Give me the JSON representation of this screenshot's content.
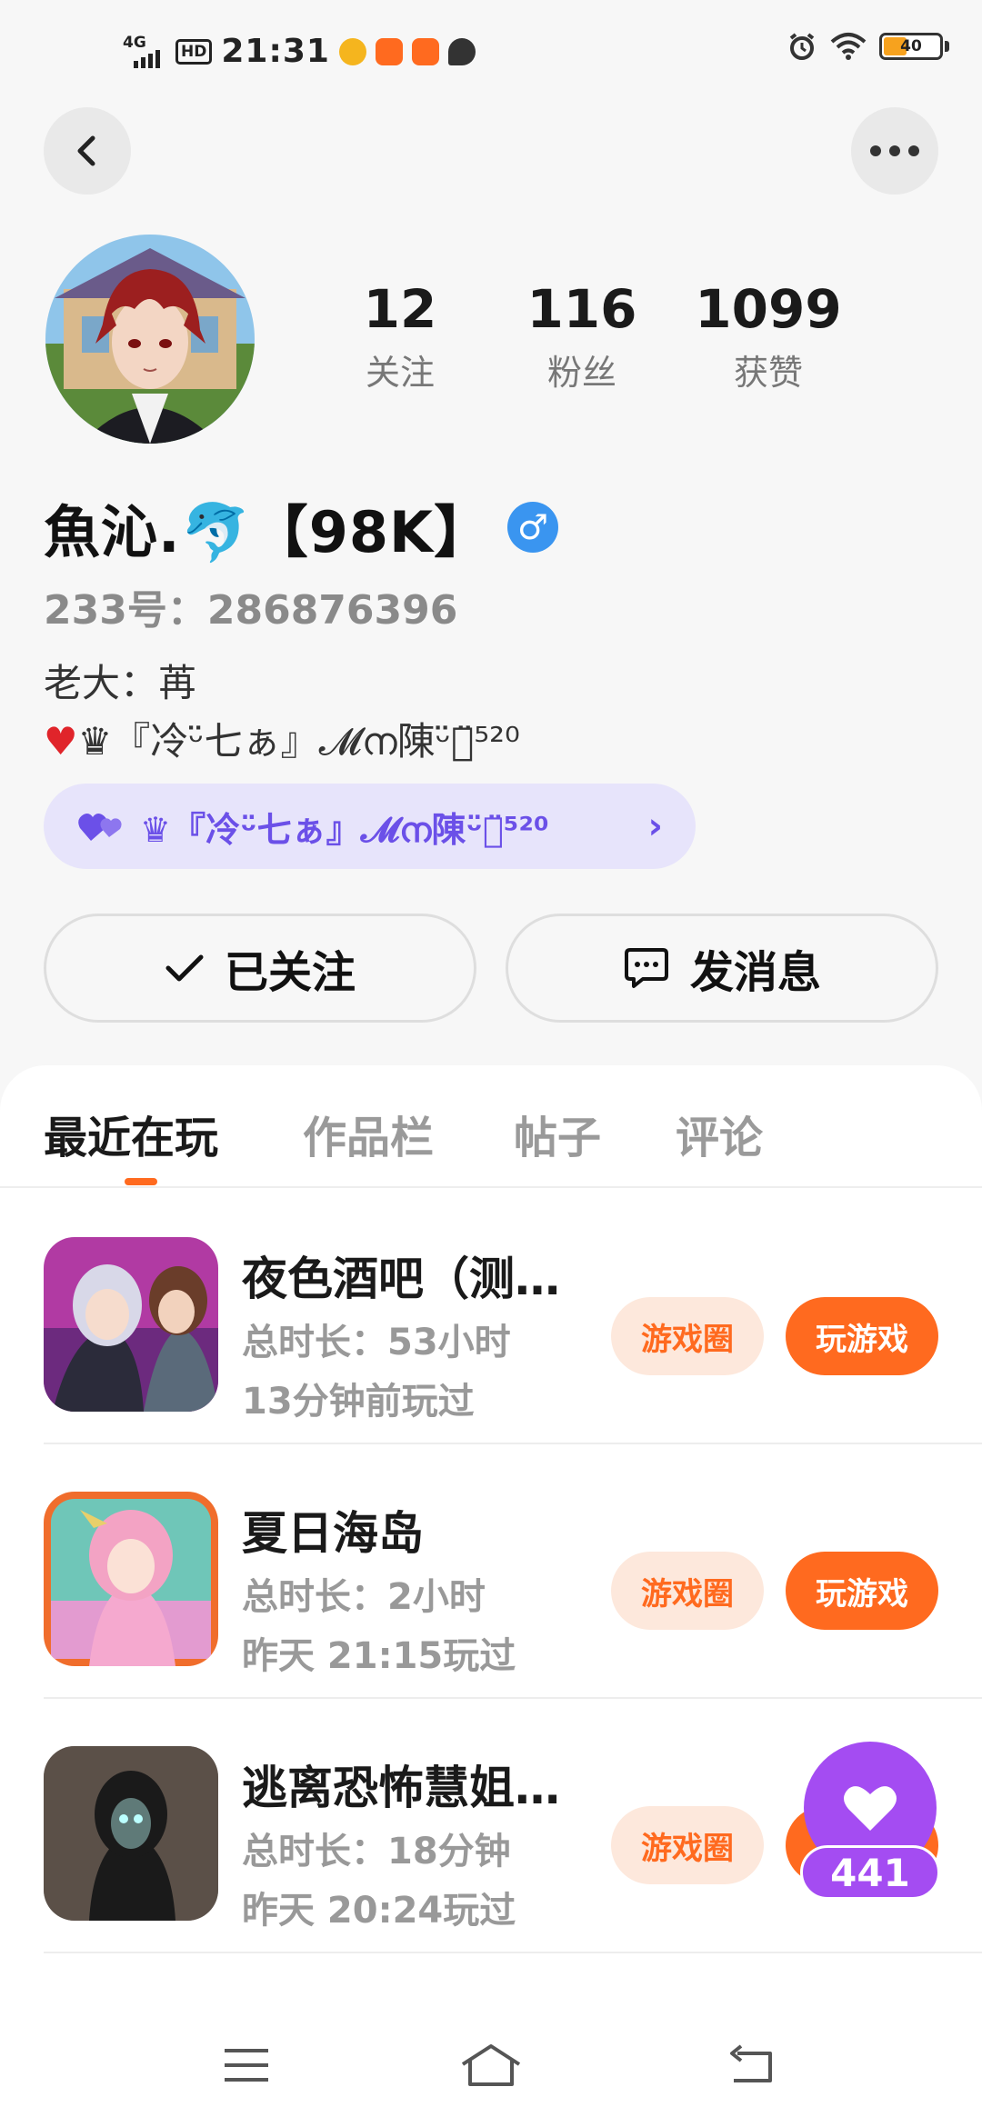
{
  "status_bar": {
    "network": "4G",
    "hd": "HD",
    "time": "21:31",
    "battery": "40",
    "battery_level": 0.4
  },
  "profile": {
    "stats": [
      {
        "value": "12",
        "label": "关注"
      },
      {
        "value": "116",
        "label": "粉丝"
      },
      {
        "value": "1099",
        "label": "获赞"
      }
    ],
    "username": "魚沁.🐬【98K】",
    "gender_symbol": "♂",
    "uid": "233号：286876396",
    "bio_line1": "老大：苒",
    "bio_line2_heart": "♥",
    "bio_line2": "♛『冷ᵕ̈七ぁ』𝓜ന陳ᵕ̈ႁ̈⁵²⁰",
    "cp_tag": "♛『冷ᵕ̈七ぁ』𝓜ന陳ᵕ̈ႁ̈⁵²⁰",
    "cp_chevron": "›",
    "follow_label": "已关注",
    "message_label": "发消息"
  },
  "tabs": [
    {
      "label": "最近在玩",
      "active": true
    },
    {
      "label": "作品栏",
      "active": false
    },
    {
      "label": "帖子",
      "active": false
    },
    {
      "label": "评论",
      "active": false
    }
  ],
  "games": [
    {
      "title": "夜色酒吧（测…",
      "duration": "总时长：53小时",
      "last_played": "13分钟前玩过",
      "circle_label": "游戏圈",
      "play_label": "玩游戏"
    },
    {
      "title": "夏日海岛",
      "duration": "总时长：2小时",
      "last_played": "昨天 21:15玩过",
      "circle_label": "游戏圈",
      "play_label": "玩游戏"
    },
    {
      "title": "逃离恐怖慧姐…",
      "duration": "总时长：18分钟",
      "last_played": "昨天 20:24玩过",
      "circle_label": "游戏圈",
      "play_label": "玩游戏"
    }
  ],
  "floating_like": {
    "count": "441"
  },
  "colors": {
    "accent": "#ff6a1f",
    "accent_soft": "#fde8dc",
    "cp_purple": "#6b50e8",
    "like_purple": "#a44cf2",
    "gender_blue": "#3a95f0"
  },
  "icons": {
    "back": "back-arrow-icon",
    "more": "more-dots-icon",
    "check": "check-icon",
    "message": "chat-bubble-icon",
    "like": "heart-icon",
    "nav_menu": "menu-icon",
    "nav_home": "home-icon",
    "nav_back": "back-icon"
  }
}
